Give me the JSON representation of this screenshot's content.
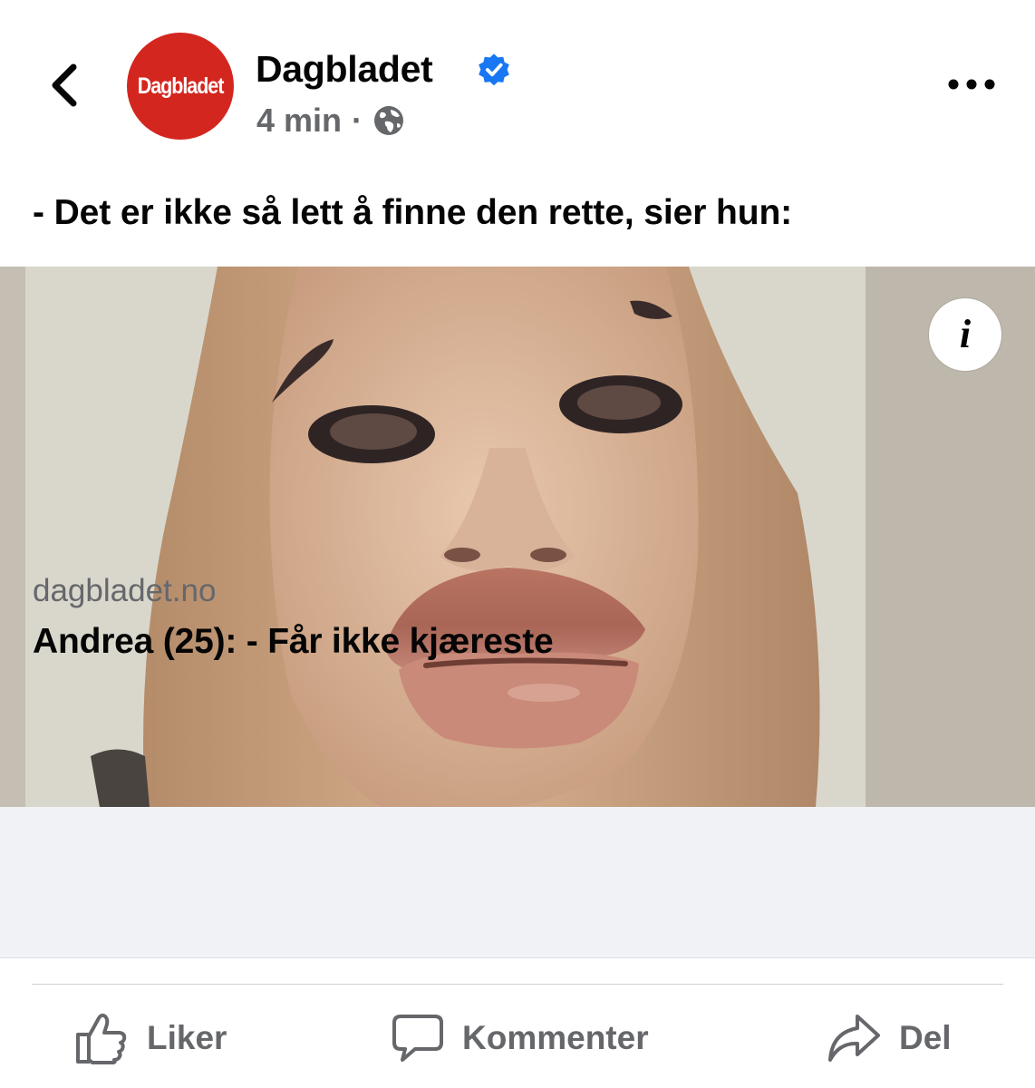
{
  "header": {
    "back_icon": "chevron-left-icon",
    "avatar_text": "Dagbladet",
    "page_name": "Dagbladet",
    "verified_icon": "verified-badge-icon",
    "time": "4 min",
    "separator": "·",
    "audience_icon": "globe-icon",
    "more_icon": "more-horizontal-icon"
  },
  "post": {
    "caption": "- Det er ikke så lett å finne den rette, sier hun:"
  },
  "link": {
    "info_icon": "info-icon",
    "info_glyph": "i",
    "domain": "dagbladet.no",
    "title": "Andrea (25): - Får ikke kjæreste"
  },
  "actions": [
    {
      "label": "Liker",
      "icon": "thumbs-up-icon"
    },
    {
      "label": "Kommenter",
      "icon": "comment-icon"
    },
    {
      "label": "Del",
      "icon": "share-icon"
    }
  ],
  "colors": {
    "brand_red": "#d3261f",
    "verified_blue": "#1877f2",
    "secondary_text": "#65676b",
    "link_background": "#f0f2f5"
  }
}
